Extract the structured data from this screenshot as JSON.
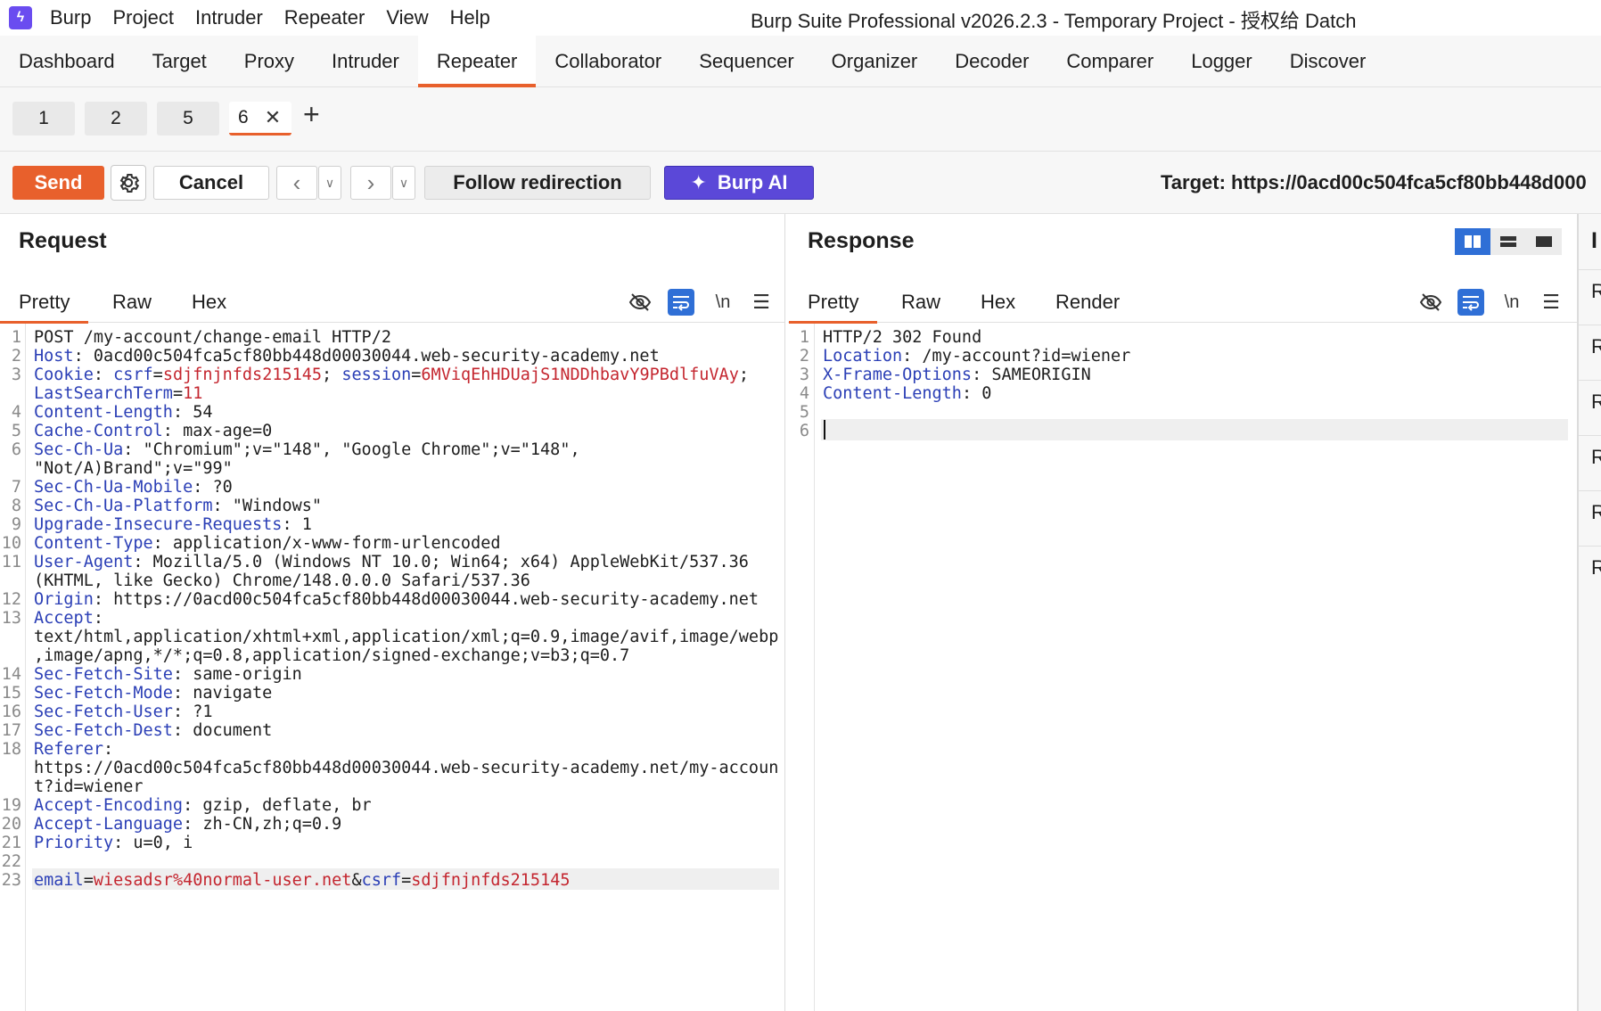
{
  "app": {
    "menu": [
      "Burp",
      "Project",
      "Intruder",
      "Repeater",
      "View",
      "Help"
    ],
    "window_title": "Burp Suite Professional v2026.2.3 - Temporary Project - 授权给 Datch"
  },
  "main_tabs": [
    "Dashboard",
    "Target",
    "Proxy",
    "Intruder",
    "Repeater",
    "Collaborator",
    "Sequencer",
    "Organizer",
    "Decoder",
    "Comparer",
    "Logger",
    "Discover"
  ],
  "active_main_tab": "Repeater",
  "repeater_tabs": [
    "1",
    "2",
    "5",
    "6"
  ],
  "active_repeater_tab": "6",
  "toolbar": {
    "send": "Send",
    "cancel": "Cancel",
    "follow": "Follow redirection",
    "ai": "Burp AI",
    "target": "Target: https://0acd00c504fca5cf80bb448d000"
  },
  "request": {
    "title": "Request",
    "tabs": [
      "Pretty",
      "Raw",
      "Hex"
    ],
    "newline_label": "\\n",
    "lines": [
      {
        "n": "1",
        "parts": [
          [
            "v",
            "POST /my-account/change-email HTTP/2"
          ]
        ]
      },
      {
        "n": "2",
        "parts": [
          [
            "k",
            "Host"
          ],
          [
            "v",
            ": 0acd00c504fca5cf80bb448d00030044.web-security-academy.net"
          ]
        ]
      },
      {
        "n": "3",
        "parts": [
          [
            "k",
            "Cookie"
          ],
          [
            "v",
            ": "
          ],
          [
            "k",
            "csrf"
          ],
          [
            "v",
            "="
          ],
          [
            "r",
            "sdjfnjnfds215145"
          ],
          [
            "v",
            "; "
          ],
          [
            "k",
            "session"
          ],
          [
            "v",
            "="
          ],
          [
            "r",
            "6MViqEhHDUajS1NDDhbavY9PBdlfuVAy"
          ],
          [
            "v",
            ";"
          ]
        ]
      },
      {
        "n": "",
        "parts": [
          [
            "k",
            "LastSearchTerm"
          ],
          [
            "v",
            "="
          ],
          [
            "r",
            "11"
          ]
        ]
      },
      {
        "n": "4",
        "parts": [
          [
            "k",
            "Content-Length"
          ],
          [
            "v",
            ": 54"
          ]
        ]
      },
      {
        "n": "5",
        "parts": [
          [
            "k",
            "Cache-Control"
          ],
          [
            "v",
            ": max-age=0"
          ]
        ]
      },
      {
        "n": "6",
        "parts": [
          [
            "k",
            "Sec-Ch-Ua"
          ],
          [
            "v",
            ": \"Chromium\";v=\"148\", \"Google Chrome\";v=\"148\","
          ]
        ]
      },
      {
        "n": "",
        "parts": [
          [
            "v",
            "\"Not/A)Brand\";v=\"99\""
          ]
        ]
      },
      {
        "n": "7",
        "parts": [
          [
            "k",
            "Sec-Ch-Ua-Mobile"
          ],
          [
            "v",
            ": ?0"
          ]
        ]
      },
      {
        "n": "8",
        "parts": [
          [
            "k",
            "Sec-Ch-Ua-Platform"
          ],
          [
            "v",
            ": \"Windows\""
          ]
        ]
      },
      {
        "n": "9",
        "parts": [
          [
            "k",
            "Upgrade-Insecure-Requests"
          ],
          [
            "v",
            ": 1"
          ]
        ]
      },
      {
        "n": "10",
        "parts": [
          [
            "k",
            "Content-Type"
          ],
          [
            "v",
            ": application/x-www-form-urlencoded"
          ]
        ]
      },
      {
        "n": "11",
        "parts": [
          [
            "k",
            "User-Agent"
          ],
          [
            "v",
            ": Mozilla/5.0 (Windows NT 10.0; Win64; x64) AppleWebKit/537.36"
          ]
        ]
      },
      {
        "n": "",
        "parts": [
          [
            "v",
            "(KHTML, like Gecko) Chrome/148.0.0.0 Safari/537.36"
          ]
        ]
      },
      {
        "n": "12",
        "parts": [
          [
            "k",
            "Origin"
          ],
          [
            "v",
            ": https://0acd00c504fca5cf80bb448d00030044.web-security-academy.net"
          ]
        ]
      },
      {
        "n": "13",
        "parts": [
          [
            "k",
            "Accept"
          ],
          [
            "v",
            ":"
          ]
        ]
      },
      {
        "n": "",
        "parts": [
          [
            "v",
            "text/html,application/xhtml+xml,application/xml;q=0.9,image/avif,image/webp"
          ]
        ]
      },
      {
        "n": "",
        "parts": [
          [
            "v",
            ",image/apng,*/*;q=0.8,application/signed-exchange;v=b3;q=0.7"
          ]
        ]
      },
      {
        "n": "14",
        "parts": [
          [
            "k",
            "Sec-Fetch-Site"
          ],
          [
            "v",
            ": same-origin"
          ]
        ]
      },
      {
        "n": "15",
        "parts": [
          [
            "k",
            "Sec-Fetch-Mode"
          ],
          [
            "v",
            ": navigate"
          ]
        ]
      },
      {
        "n": "16",
        "parts": [
          [
            "k",
            "Sec-Fetch-User"
          ],
          [
            "v",
            ": ?1"
          ]
        ]
      },
      {
        "n": "17",
        "parts": [
          [
            "k",
            "Sec-Fetch-Dest"
          ],
          [
            "v",
            ": document"
          ]
        ]
      },
      {
        "n": "18",
        "parts": [
          [
            "k",
            "Referer"
          ],
          [
            "v",
            ":"
          ]
        ]
      },
      {
        "n": "",
        "parts": [
          [
            "v",
            "https://0acd00c504fca5cf80bb448d00030044.web-security-academy.net/my-accoun"
          ]
        ]
      },
      {
        "n": "",
        "parts": [
          [
            "v",
            "t?id=wiener"
          ]
        ]
      },
      {
        "n": "19",
        "parts": [
          [
            "k",
            "Accept-Encoding"
          ],
          [
            "v",
            ": gzip, deflate, br"
          ]
        ]
      },
      {
        "n": "20",
        "parts": [
          [
            "k",
            "Accept-Language"
          ],
          [
            "v",
            ": zh-CN,zh;q=0.9"
          ]
        ]
      },
      {
        "n": "21",
        "parts": [
          [
            "k",
            "Priority"
          ],
          [
            "v",
            ": u=0, i"
          ]
        ]
      },
      {
        "n": "22",
        "parts": []
      },
      {
        "n": "23",
        "parts": [
          [
            "k",
            "email"
          ],
          [
            "v",
            "="
          ],
          [
            "r",
            "wiesadsr%40normal-user.net"
          ],
          [
            "v",
            "&"
          ],
          [
            "k",
            "csrf"
          ],
          [
            "v",
            "="
          ],
          [
            "r",
            "sdjfnjnfds215145"
          ]
        ],
        "highlight": true
      }
    ]
  },
  "response": {
    "title": "Response",
    "tabs": [
      "Pretty",
      "Raw",
      "Hex",
      "Render"
    ],
    "newline_label": "\\n",
    "lines": [
      {
        "n": "1",
        "parts": [
          [
            "v",
            "HTTP/2 302 Found"
          ]
        ]
      },
      {
        "n": "2",
        "parts": [
          [
            "k",
            "Location"
          ],
          [
            "v",
            ": /my-account?id=wiener"
          ]
        ]
      },
      {
        "n": "3",
        "parts": [
          [
            "k",
            "X-Frame-Options"
          ],
          [
            "v",
            ": SAMEORIGIN"
          ]
        ]
      },
      {
        "n": "4",
        "parts": [
          [
            "k",
            "Content-Length"
          ],
          [
            "v",
            ": 0"
          ]
        ]
      },
      {
        "n": "5",
        "parts": []
      },
      {
        "n": "6",
        "parts": [],
        "highlight": true,
        "caret": true
      }
    ]
  },
  "inspector": {
    "title": "I",
    "items": [
      "R",
      "R",
      "R",
      "R",
      "R",
      "R"
    ]
  },
  "colors": {
    "accent": "#e8602c",
    "ai": "#5b48d8",
    "key": "#2b3fb6",
    "value_red": "#c4262f",
    "toggle_active": "#2f6fd6"
  }
}
